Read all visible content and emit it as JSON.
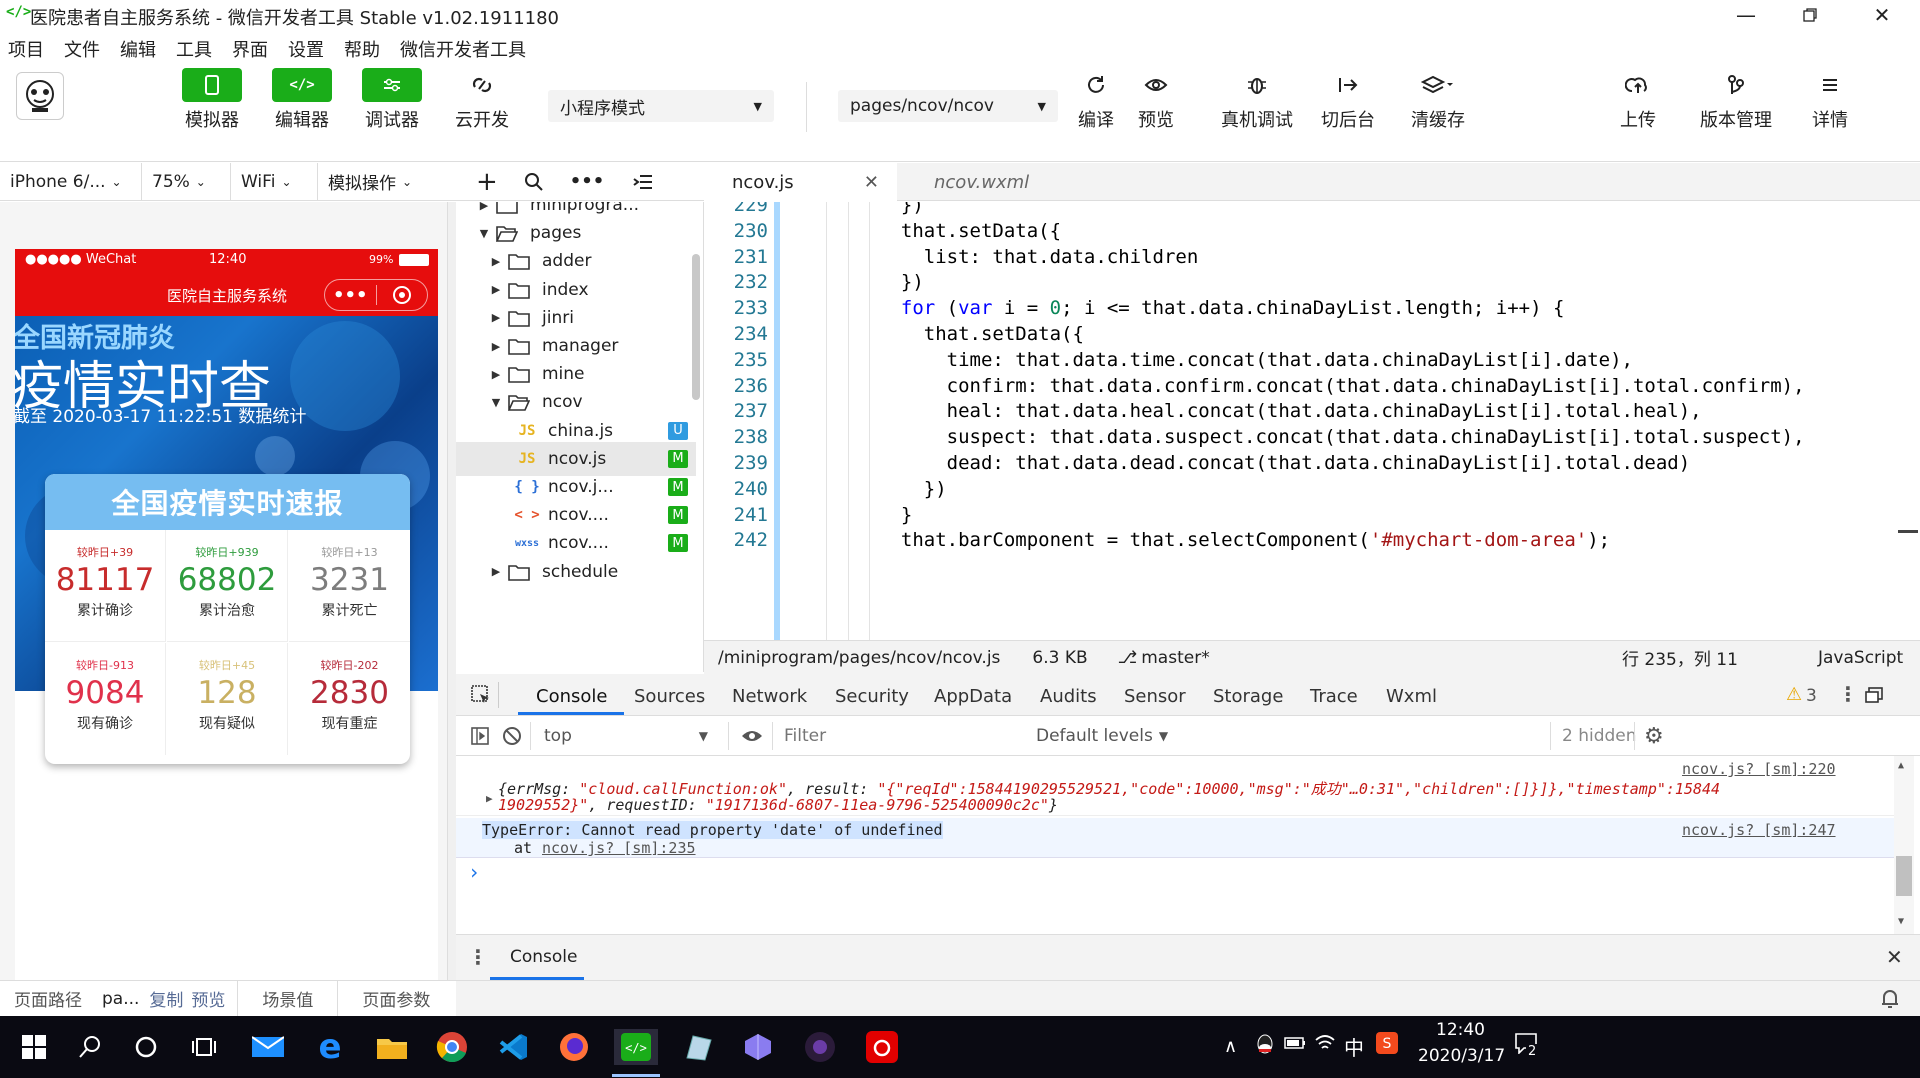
{
  "window": {
    "title": "医院患者自主服务系统 - 微信开发者工具 Stable v1.02.1911180",
    "logo_glyph": "</>"
  },
  "menu": [
    "项目",
    "文件",
    "编辑",
    "工具",
    "界面",
    "设置",
    "帮助",
    "微信开发者工具"
  ],
  "toolbar": {
    "simulator": "模拟器",
    "editor": "编辑器",
    "debugger": "调试器",
    "cloud": "云开发",
    "mode_select": "小程序模式",
    "page_select": "pages/ncov/ncov",
    "compile": "编译",
    "preview": "预览",
    "remote_debug": "真机调试",
    "background": "切后台",
    "clear_cache": "清缓存",
    "upload": "上传",
    "version": "版本管理",
    "details": "详情"
  },
  "simbar": {
    "device": "iPhone 6/...",
    "zoom": "75%",
    "network": "WiFi",
    "ops": "模拟操作"
  },
  "phone": {
    "status_left": "●●●●● WeChat",
    "status_time": "12:40",
    "status_battery": "99%",
    "nav_title": "医院自主服务系统",
    "banner_line1": "全国新冠肺炎",
    "banner_line2": "疫情实时查",
    "banner_line3": "截至 2020-03-17 11:22:51 数据统计",
    "card_title": "全国疫情实时速报",
    "stats": [
      {
        "delta": "较昨日+39",
        "value": "81117",
        "name": "累计确诊",
        "color": "#c72c2c",
        "dcolor": "#c72c2c"
      },
      {
        "delta": "较昨日+939",
        "value": "68802",
        "name": "累计治愈",
        "color": "#2e9c3d",
        "dcolor": "#2e9c3d"
      },
      {
        "delta": "较昨日+13",
        "value": "3231",
        "name": "累计死亡",
        "color": "#7d7d7d",
        "dcolor": "#999999"
      },
      {
        "delta": "较昨日-913",
        "value": "9084",
        "name": "现有确诊",
        "color": "#e0314b",
        "dcolor": "#e0314b"
      },
      {
        "delta": "较昨日+45",
        "value": "128",
        "name": "现有疑似",
        "color": "#c9b062",
        "dcolor": "#d8c27a"
      },
      {
        "delta": "较昨日-202",
        "value": "2830",
        "name": "现有重症",
        "color": "#b62b3a",
        "dcolor": "#b62b3a"
      }
    ]
  },
  "simfoot": {
    "path_label": "页面路径",
    "path_value": "pa...",
    "copy": "复制",
    "preview": "预览",
    "scene": "场景值",
    "params": "页面参数"
  },
  "tree": {
    "rows": [
      {
        "label": "miniprogra...",
        "type": "folder",
        "arrow": "▶",
        "indent": 0
      },
      {
        "label": "pages",
        "type": "folder-open",
        "arrow": "▼",
        "indent": 0
      },
      {
        "label": "adder",
        "type": "folder",
        "arrow": "▶",
        "indent": 1
      },
      {
        "label": "index",
        "type": "folder",
        "arrow": "▶",
        "indent": 1
      },
      {
        "label": "jinri",
        "type": "folder",
        "arrow": "▶",
        "indent": 1
      },
      {
        "label": "manager",
        "type": "folder",
        "arrow": "▶",
        "indent": 1
      },
      {
        "label": "mine",
        "type": "folder",
        "arrow": "▶",
        "indent": 1
      },
      {
        "label": "ncov",
        "type": "folder-open",
        "arrow": "▼",
        "indent": 1
      },
      {
        "label": "china.js",
        "type": "js",
        "icon": "JS",
        "badge": "U",
        "indent": 2
      },
      {
        "label": "ncov.js",
        "type": "js",
        "icon": "JS",
        "badge": "M",
        "indent": 2,
        "selected": true
      },
      {
        "label": "ncov.j...",
        "type": "json",
        "icon": "{ }",
        "badge": "M",
        "indent": 2
      },
      {
        "label": "ncov....",
        "type": "wxml",
        "icon": "< >",
        "badge": "M",
        "indent": 2
      },
      {
        "label": "ncov....",
        "type": "wxss",
        "icon": "wxss",
        "badge": "M",
        "indent": 2
      },
      {
        "label": "schedule",
        "type": "folder",
        "arrow": "▶",
        "indent": 1
      }
    ]
  },
  "editor": {
    "tabs": [
      "ncov.js",
      "ncov.wxml"
    ],
    "lines": [
      {
        "n": "229",
        "code": "  })"
      },
      {
        "n": "230",
        "code": "  that.setData({"
      },
      {
        "n": "231",
        "code": "    list: that.data.children"
      },
      {
        "n": "232",
        "code": "  })"
      },
      {
        "n": "233",
        "code": "  for (var i = 0; i <= that.data.chinaDayList.length; i++) {"
      },
      {
        "n": "234",
        "code": "    that.setData({"
      },
      {
        "n": "235",
        "code": "      time: that.data.time.concat(that.data.chinaDayList[i].date),"
      },
      {
        "n": "236",
        "code": "      confirm: that.data.confirm.concat(that.data.chinaDayList[i].total.confirm),"
      },
      {
        "n": "237",
        "code": "      heal: that.data.heal.concat(that.data.chinaDayList[i].total.heal),"
      },
      {
        "n": "238",
        "code": "      suspect: that.data.suspect.concat(that.data.chinaDayList[i].total.suspect),"
      },
      {
        "n": "239",
        "code": "      dead: that.data.dead.concat(that.data.chinaDayList[i].total.dead)"
      },
      {
        "n": "240",
        "code": "    })"
      },
      {
        "n": "241",
        "code": "  }"
      },
      {
        "n": "242",
        "code": "  that.barComponent = that.selectComponent('#mychart-dom-area');"
      }
    ]
  },
  "statusbar": {
    "path": "/miniprogram/pages/ncov/ncov.js",
    "size": "6.3 KB",
    "branch": "master*",
    "position": "行 235，列 11",
    "language": "JavaScript"
  },
  "devtools": {
    "tabs": [
      "Console",
      "Sources",
      "Network",
      "Security",
      "AppData",
      "Audits",
      "Sensor",
      "Storage",
      "Trace",
      "Wxml"
    ],
    "warning_count": "3",
    "context": "top",
    "filter_placeholder": "Filter",
    "levels": "Default levels",
    "hidden": "2 hidden",
    "log1_source": "ncov.js? [sm]:220",
    "log1_line1_pre": "{errMsg: ",
    "log1_line1_str": "\"cloud.callFunction:ok\"",
    "log1_line1_mid": ", result: ",
    "log1_line1_res": "\"{\"reqId\":15844190295529521,\"code\":10000,\"msg\":\"成功\"…0:31\",\"children\":[]}]},\"timestamp\":15844",
    "log1_line2_res": "19029552}\"",
    "log1_line2_mid": ", requestID: ",
    "log1_line2_str": "\"1917136d-6807-11ea-9796-525400090c2c\"",
    "log1_line2_end": "}",
    "error_text": "TypeError: Cannot read property 'date' of undefined",
    "error_source": "ncov.js? [sm]:247",
    "error_at": "at",
    "error_link": "ncov.js? [sm]:235",
    "prompt": "›",
    "drawer_tab": "Console"
  },
  "taskbar": {
    "ime": "中",
    "time": "12:40",
    "date": "2020/3/17",
    "notif": "2"
  }
}
